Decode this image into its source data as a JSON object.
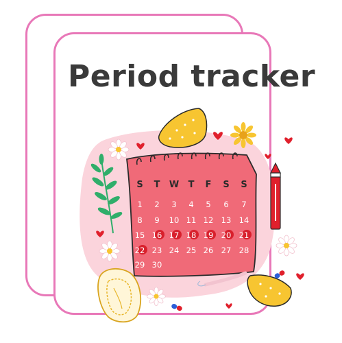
{
  "title": "Period tracker",
  "weekdays": [
    "S",
    "T",
    "W",
    "T",
    "F",
    "S",
    "S"
  ],
  "days": [
    [
      "1",
      "2",
      "3",
      "4",
      "5",
      "6",
      "7"
    ],
    [
      "8",
      "9",
      "10",
      "11",
      "12",
      "13",
      "14"
    ],
    [
      "15",
      "16",
      "17",
      "18",
      "19",
      "20",
      "21"
    ],
    [
      "22",
      "23",
      "24",
      "25",
      "26",
      "27",
      "28"
    ],
    [
      "29",
      "30"
    ]
  ],
  "period_days": [
    "16",
    "17",
    "18",
    "19",
    "20",
    "21",
    "22"
  ],
  "colors": {
    "card_border": "#e878b8",
    "title": "#3a3a3a",
    "calendar": "#f06a78",
    "blob": "#fbd4dc",
    "period_marker": "#d8202c",
    "heart": "#e0202c",
    "yellow": "#f7c531",
    "leaf": "#2fae6a"
  },
  "icons": [
    "calendar-icon",
    "heart-icon",
    "flower-icon",
    "pad-icon",
    "leaf-icon",
    "pen-icon",
    "pill-icon",
    "sun-flower-icon"
  ]
}
